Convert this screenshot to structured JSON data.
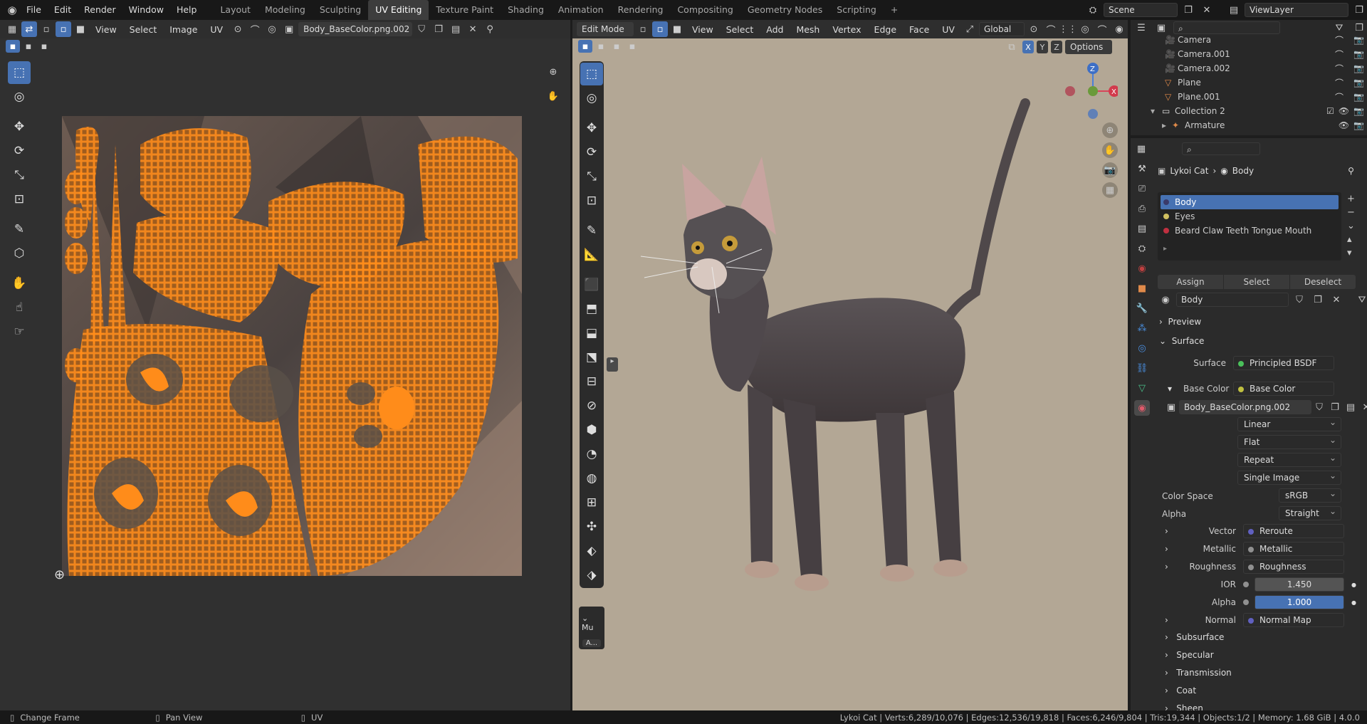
{
  "topbar": {
    "menus": [
      "File",
      "Edit",
      "Render",
      "Window",
      "Help"
    ],
    "workspaces": [
      "Layout",
      "Modeling",
      "Sculpting",
      "UV Editing",
      "Texture Paint",
      "Shading",
      "Animation",
      "Rendering",
      "Compositing",
      "Geometry Nodes",
      "Scripting"
    ],
    "active_workspace": "UV Editing",
    "add_tab": "+",
    "scene": "Scene",
    "view_layer": "ViewLayer"
  },
  "uv_editor": {
    "menus": [
      "View",
      "Select",
      "Image",
      "UV"
    ],
    "image_name": "Body_BaseColor.png.002"
  },
  "viewport": {
    "mode": "Edit Mode",
    "menus": [
      "View",
      "Select",
      "Add",
      "Mesh",
      "Vertex",
      "Edge",
      "Face",
      "UV"
    ],
    "orientation": "Global",
    "axes": [
      "X",
      "Y",
      "Z"
    ],
    "options": "Options",
    "gizmo_labels": [
      "Z",
      "X"
    ],
    "side_panel_tab": "Mu",
    "side_panel_button": "A..."
  },
  "outliner": {
    "items": [
      {
        "name": "Camera",
        "icon": "camera-icon"
      },
      {
        "name": "Camera.001",
        "icon": "camera-icon"
      },
      {
        "name": "Camera.002",
        "icon": "camera-icon"
      },
      {
        "name": "Plane",
        "icon": "mesh-icon"
      },
      {
        "name": "Plane.001",
        "icon": "mesh-icon"
      }
    ],
    "collection": "Collection 2",
    "armature": "Armature"
  },
  "properties": {
    "breadcrumb_object": "Lykoi Cat",
    "breadcrumb_material": "Body",
    "material_slots": [
      "Body",
      "Eyes",
      "Beard Claw Teeth Tongue Mouth"
    ],
    "buttons": {
      "assign": "Assign",
      "select": "Select",
      "deselect": "Deselect"
    },
    "material_name": "Body",
    "sections": {
      "preview": "Preview",
      "surface": "Surface"
    },
    "surface": {
      "label": "Surface",
      "value": "Principled BSDF"
    },
    "base_color": {
      "label": "Base Color",
      "value": "Base Color"
    },
    "image_name": "Body_BaseColor.png.002",
    "interpolation": "Linear",
    "projection": "Flat",
    "extension": "Repeat",
    "source": "Single Image",
    "color_space": {
      "label": "Color Space",
      "value": "sRGB"
    },
    "alpha_mode": {
      "label": "Alpha",
      "value": "Straight"
    },
    "vector": {
      "label": "Vector",
      "value": "Reroute"
    },
    "metallic": {
      "label": "Metallic",
      "value": "Metallic"
    },
    "roughness": {
      "label": "Roughness",
      "value": "Roughness"
    },
    "ior": {
      "label": "IOR",
      "value": "1.450"
    },
    "alpha": {
      "label": "Alpha",
      "value": "1.000"
    },
    "normal": {
      "label": "Normal",
      "value": "Normal Map"
    },
    "collapsed": [
      "Subsurface",
      "Specular",
      "Transmission",
      "Coat",
      "Sheen"
    ]
  },
  "status": {
    "left": [
      {
        "label": "Change Frame"
      },
      {
        "label": "Pan View"
      },
      {
        "label": "UV"
      }
    ],
    "stats": "Lykoi Cat | Verts:6,289/10,076 | Edges:12,536/19,818 | Faces:6,246/9,804 | Tris:19,344 | Objects:1/2 | Memory: 1.68 GiB | 4.0.0"
  },
  "colors": {
    "accent": "#4772b3",
    "uv_orange": "#ff8c1a",
    "viewport_bg": "#b3a795",
    "header": "#2e2e2e"
  }
}
